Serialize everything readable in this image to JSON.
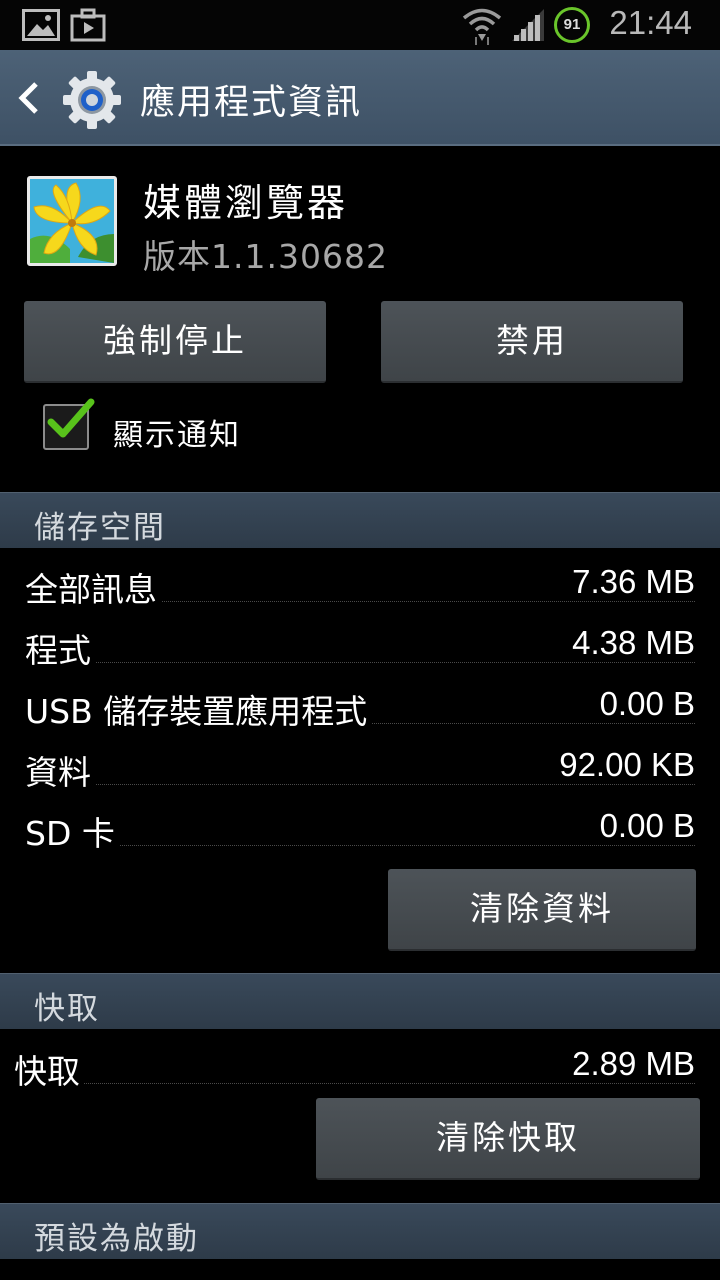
{
  "status_bar": {
    "clock": "21:44",
    "battery": "91",
    "icons": [
      "gallery-icon",
      "briefcase-icon",
      "wifi-icon",
      "signal-icon",
      "battery-icon"
    ],
    "battery_color": "#6ac52b"
  },
  "action_bar": {
    "title": "應用程式資訊",
    "back_icon": "back-arrow-icon",
    "app_icon": "settings-gear-icon",
    "background": "#435669"
  },
  "app": {
    "name": "媒體瀏覽器",
    "version": "版本1.1.30682",
    "icon": "yellow-lily-flower-icon"
  },
  "buttons": {
    "force_stop": "強制停止",
    "disable": "禁用"
  },
  "notification": {
    "label": "顯示通知",
    "checked": true
  },
  "storage": {
    "header": "儲存空間",
    "rows": [
      {
        "label": "全部訊息",
        "value": "7.36 MB"
      },
      {
        "label": "程式",
        "value": "4.38 MB"
      },
      {
        "label": "USB 儲存裝置應用程式",
        "value": "0.00 B"
      },
      {
        "label": "資料",
        "value": "92.00 KB"
      },
      {
        "label": "SD 卡",
        "value": "0.00 B"
      }
    ],
    "clear_data": "清除資料"
  },
  "cache": {
    "header": "快取",
    "row": {
      "label": "快取",
      "value": "2.89 MB"
    },
    "clear_cache": "清除快取"
  },
  "launch_default": {
    "header": "預設為啟動"
  }
}
